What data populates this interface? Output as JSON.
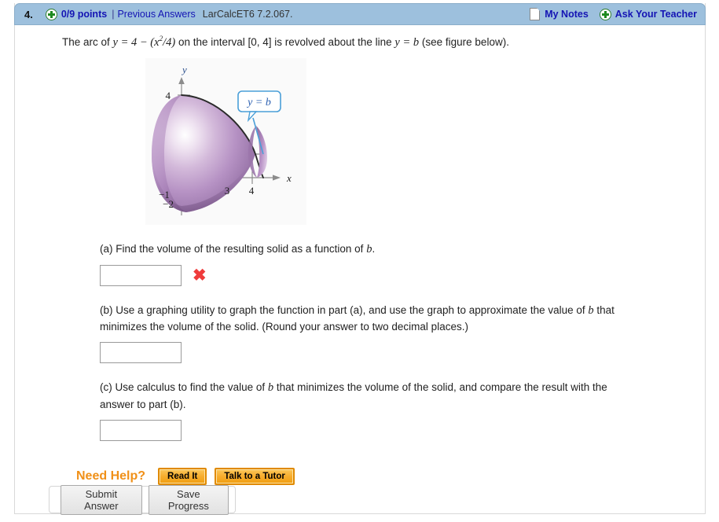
{
  "header": {
    "question_number": "4.",
    "points": "0/9 points",
    "separator": "|",
    "previous_answers": "Previous Answers",
    "question_id": "LarCalcET6 7.2.067.",
    "my_notes": "My Notes",
    "ask_your_teacher": "Ask Your Teacher",
    "plus_icon": "plus-circle-icon",
    "note_icon": "note-page-icon",
    "bar_color": "#9dc0dd",
    "link_color": "#1414b4"
  },
  "prompt": {
    "text_1": "The arc of",
    "eq_1": "y = 4 − (x",
    "eq_1_exp": "2",
    "eq_1_tail": "/4)",
    "text_2": "on the interval [0, 4] is revolved about the line",
    "eq_2": "y = b",
    "text_3": "(see figure below)."
  },
  "figure": {
    "name": "solid-of-revolution-figure",
    "axis_x_label": "x",
    "axis_y_label": "y",
    "callout_label": "y = b",
    "tick_labels": [
      "4",
      "3",
      "4",
      "−1",
      "−2"
    ],
    "solid_color": "#b08cbe",
    "callout_border_color": "#4a9fd8",
    "callout_text_color": "#2b5fb0"
  },
  "parts": [
    {
      "id": "a",
      "text_before": "(a) Find the volume of the resulting solid as a function of ",
      "italic_var": "b",
      "text_after": ".",
      "answer_value": "",
      "placeholder": "",
      "status": "incorrect",
      "status_mark": "✖"
    },
    {
      "id": "b",
      "line1_before": "(b) Use a graphing utility to graph the function in part (a), and use the graph to approximate the value of ",
      "line1_var": "b",
      "line1_after": " that",
      "line2": "minimizes the volume of the solid. (Round your answer to two decimal places.)",
      "answer_value": "",
      "placeholder": "",
      "status": "none"
    },
    {
      "id": "c",
      "line1_before": "(c) Use calculus to find the value of ",
      "line1_var": "b",
      "line1_after": " that minimizes the volume of the solid, and compare the result with the",
      "line2": "answer to part (b).",
      "answer_value": "",
      "placeholder": "",
      "status": "none"
    }
  ],
  "need_help": {
    "label": "Need Help?",
    "label_color": "#f09018",
    "buttons": [
      "Read It",
      "Talk to a Tutor"
    ]
  },
  "footer": {
    "buttons": [
      "Submit Answer",
      "Save Progress"
    ]
  }
}
